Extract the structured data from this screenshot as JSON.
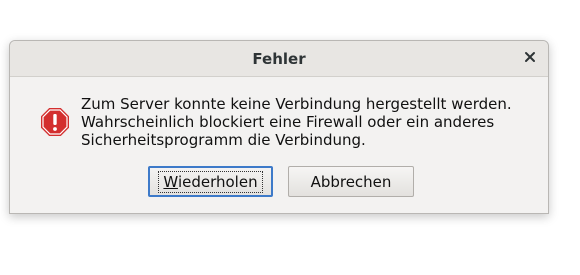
{
  "dialog": {
    "title": "Fehler",
    "message_lines": [
      "Zum Server konnte keine Verbindung hergestellt werden.",
      "Wahrscheinlich blockiert eine Firewall oder ein anderes",
      "Sicherheitsprogramm die Verbindung."
    ],
    "icon": "error-icon",
    "buttons": {
      "retry_mnemonic": "W",
      "retry_rest": "iederholen",
      "cancel": "Abbrechen"
    }
  },
  "colors": {
    "error_red": "#d32f2f",
    "focus_blue": "#3d7ac9",
    "titlebar_bg": "#e8e6e3",
    "dialog_bg": "#f3f2f1"
  }
}
